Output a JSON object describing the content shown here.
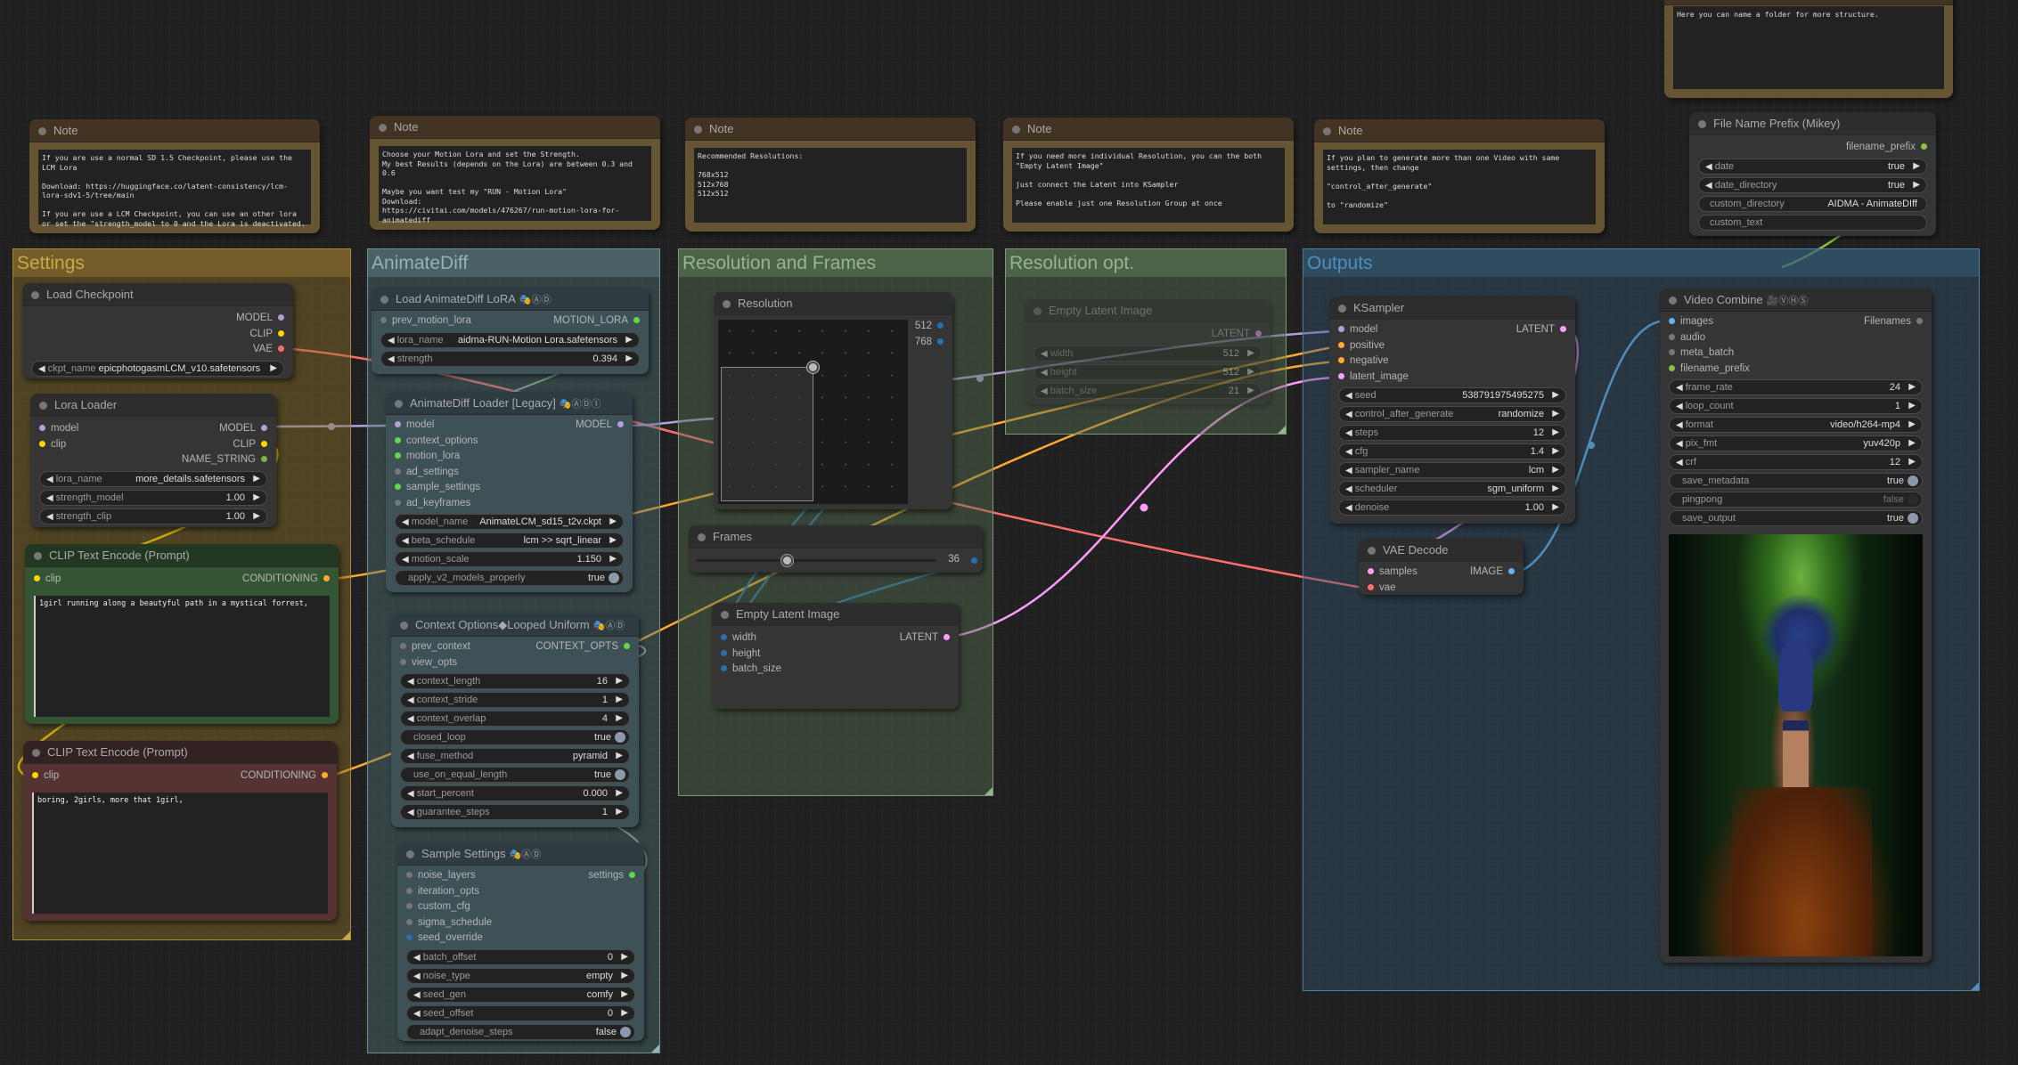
{
  "groups": {
    "settings": "Settings",
    "animatediff": "AnimateDiff",
    "resolution_frames": "Resolution and Frames",
    "resolution_opt": "Resolution opt.",
    "outputs": "Outputs"
  },
  "notes": [
    {
      "title": "Note",
      "text": "If you are use a normal SD 1.5 Checkpoint, please use the LCM Lora\n\nDownload: https://huggingface.co/latent-consistency/lcm-lora-sdv1-5/tree/main\n\nIf you are use a LCM Checkpoint, you can use an other lora or set the \"strength_model to 0 and the Lora is deactivated."
    },
    {
      "title": "Note",
      "text": "Choose your Motion Lora and set the Strength.\nMy best Results (depends on the Lora) are between 0.3 and 0.6\n\nMaybe you want test my \"RUN - Motion Lora\"\nDownload:\nhttps://civitai.com/models/476267/run-motion-lora-for-animatediff"
    },
    {
      "title": "Note",
      "text": "Recommended Resolutions:\n\n768x512\n512x768\n512x512"
    },
    {
      "title": "Note",
      "text": "If you need more individual Resolution, you can the both \"Empty Latent Image\"\n\njust connect the Latent into KSampler\n\nPlease enable just one Resolution Group at once"
    },
    {
      "title": "Note",
      "text": "If you plan to generate more than one Video with same settings, then change\n\n\"control_after_generate\"\n\nto \"randomize\""
    },
    {
      "title": "",
      "text": "Here you can name a folder for more structure."
    }
  ],
  "load_checkpoint": {
    "title": "Load Checkpoint",
    "outputs": [
      "MODEL",
      "CLIP",
      "VAE"
    ],
    "ckpt_name_label": "ckpt_name",
    "ckpt_name": "epicphotogasmLCM_v10.safetensors"
  },
  "lora_loader": {
    "title": "Lora Loader",
    "inputs": [
      "model",
      "clip"
    ],
    "outputs": [
      "MODEL",
      "CLIP",
      "NAME_STRING"
    ],
    "widgets": [
      {
        "label": "lora_name",
        "value": "more_details.safetensors"
      },
      {
        "label": "strength_model",
        "value": "1.00"
      },
      {
        "label": "strength_clip",
        "value": "1.00"
      }
    ]
  },
  "clip_positive": {
    "title": "CLIP Text Encode (Prompt)",
    "input": "clip",
    "output": "CONDITIONING",
    "text": "1girl running along a beautyful path in a mystical forrest,"
  },
  "clip_negative": {
    "title": "CLIP Text Encode (Prompt)",
    "input": "clip",
    "output": "CONDITIONING",
    "text": "boring, 2girls, more that 1girl,"
  },
  "animatediff_lora": {
    "title": "Load AnimateDiff LoRA",
    "badges": "🎭ⒶⒹ",
    "input": "prev_motion_lora",
    "output": "MOTION_LORA",
    "widgets": [
      {
        "label": "lora_name",
        "value": "aidma-RUN-Motion Lora.safetensors"
      },
      {
        "label": "strength",
        "value": "0.394"
      }
    ]
  },
  "animatediff_loader": {
    "title": "AnimateDiff Loader [Legacy]",
    "badges": "🎭ⒶⒹ①",
    "inputs": [
      "model",
      "context_options",
      "motion_lora",
      "ad_settings",
      "sample_settings",
      "ad_keyframes"
    ],
    "output": "MODEL",
    "widgets": [
      {
        "label": "model_name",
        "value": "AnimateLCM_sd15_t2v.ckpt"
      },
      {
        "label": "beta_schedule",
        "value": "lcm >> sqrt_linear"
      },
      {
        "label": "motion_scale",
        "value": "1.150"
      }
    ],
    "toggle": {
      "label": "apply_v2_models_properly",
      "value": "true"
    }
  },
  "context_options": {
    "title": "Context Options◆Looped Uniform",
    "badges": "🎭ⒶⒹ",
    "inputs": [
      "prev_context",
      "view_opts"
    ],
    "output": "CONTEXT_OPTS",
    "widgets": [
      {
        "label": "context_length",
        "value": "16",
        "type": "combo"
      },
      {
        "label": "context_stride",
        "value": "1",
        "type": "combo"
      },
      {
        "label": "context_overlap",
        "value": "4",
        "type": "combo"
      },
      {
        "label": "closed_loop",
        "value": "true",
        "type": "toggle"
      },
      {
        "label": "fuse_method",
        "value": "pyramid",
        "type": "combo"
      },
      {
        "label": "use_on_equal_length",
        "value": "true",
        "type": "toggle"
      },
      {
        "label": "start_percent",
        "value": "0.000",
        "type": "combo"
      },
      {
        "label": "guarantee_steps",
        "value": "1",
        "type": "combo"
      }
    ]
  },
  "sample_settings": {
    "title": "Sample Settings",
    "badges": "🎭ⒶⒹ",
    "inputs": [
      "noise_layers",
      "iteration_opts",
      "custom_cfg",
      "sigma_schedule",
      "seed_override"
    ],
    "output": "settings",
    "widgets": [
      {
        "label": "batch_offset",
        "value": "0",
        "type": "combo"
      },
      {
        "label": "noise_type",
        "value": "empty",
        "type": "combo"
      },
      {
        "label": "seed_gen",
        "value": "comfy",
        "type": "combo"
      },
      {
        "label": "seed_offset",
        "value": "0",
        "type": "combo"
      },
      {
        "label": "adapt_denoise_steps",
        "value": "false",
        "type": "toggle"
      }
    ]
  },
  "resolution": {
    "title": "Resolution",
    "outputs": [
      "512",
      "768"
    ]
  },
  "frames": {
    "title": "Frames",
    "value": "36",
    "slider_fraction": 0.38
  },
  "empty_latent": {
    "title": "Empty Latent Image",
    "inputs": [
      "width",
      "height",
      "batch_size"
    ],
    "output": "LATENT"
  },
  "empty_latent_opt": {
    "title": "Empty Latent Image",
    "output": "LATENT",
    "widgets": [
      {
        "label": "width",
        "value": "512"
      },
      {
        "label": "height",
        "value": "512"
      },
      {
        "label": "batch_size",
        "value": "21"
      }
    ]
  },
  "ksampler": {
    "title": "KSampler",
    "inputs": [
      "model",
      "positive",
      "negative",
      "latent_image"
    ],
    "output": "LATENT",
    "widgets": [
      {
        "label": "seed",
        "value": "538791975495275"
      },
      {
        "label": "control_after_generate",
        "value": "randomize"
      },
      {
        "label": "steps",
        "value": "12"
      },
      {
        "label": "cfg",
        "value": "1.4"
      },
      {
        "label": "sampler_name",
        "value": "lcm"
      },
      {
        "label": "scheduler",
        "value": "sgm_uniform"
      },
      {
        "label": "denoise",
        "value": "1.00"
      }
    ]
  },
  "vae_decode": {
    "title": "VAE Decode",
    "inputs": [
      "samples",
      "vae"
    ],
    "output": "IMAGE"
  },
  "filename_prefix": {
    "title": "File Name Prefix (Mikey)",
    "output": "filename_prefix",
    "widgets": [
      {
        "label": "date",
        "value": "true",
        "type": "combo"
      },
      {
        "label": "date_directory",
        "value": "true",
        "type": "combo"
      },
      {
        "label": "custom_directory",
        "value": "AIDMA - AnimateDIff",
        "type": "text"
      },
      {
        "label": "custom_text",
        "value": "",
        "type": "text"
      }
    ]
  },
  "video_combine": {
    "title": "Video Combine",
    "badges": "🎥ⓋⒽⓈ",
    "inputs": [
      "images",
      "audio",
      "meta_batch",
      "filename_prefix"
    ],
    "output": "Filenames",
    "widgets": [
      {
        "label": "frame_rate",
        "value": "24",
        "type": "combo"
      },
      {
        "label": "loop_count",
        "value": "1",
        "type": "combo"
      },
      {
        "label": "format",
        "value": "video/h264-mp4",
        "type": "combo"
      },
      {
        "label": "pix_fmt",
        "value": "yuv420p",
        "type": "combo"
      },
      {
        "label": "crf",
        "value": "12",
        "type": "combo"
      },
      {
        "label": "save_metadata",
        "value": "true",
        "type": "toggle"
      },
      {
        "label": "pingpong",
        "value": "false",
        "type": "toggle-off"
      },
      {
        "label": "save_output",
        "value": "true",
        "type": "toggle"
      }
    ],
    "preview": "girl running on forest path (generated preview)"
  },
  "colors": {
    "model": "#b39ddb",
    "clip": "#ffd500",
    "vae": "#ff6e6e",
    "conditioning": "#ffa931",
    "latent": "#ff9cf9",
    "int": "#2a6fa8",
    "image": "#64b5f6",
    "filename": "#8cc23f",
    "context": "#64d64a"
  }
}
